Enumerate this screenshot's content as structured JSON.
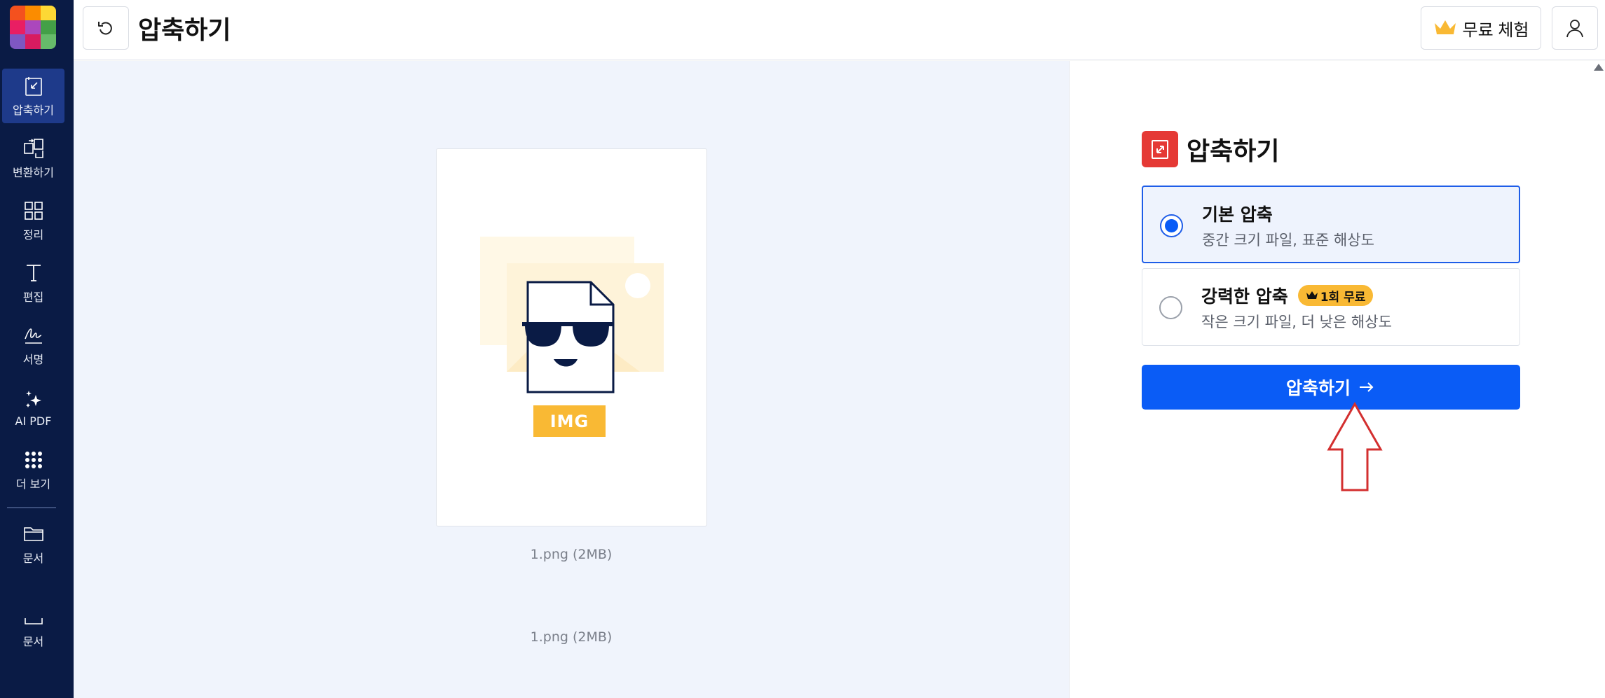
{
  "app": {
    "logo_colors": [
      "#f4511e",
      "#fb8c00",
      "#fdd835",
      "#e91e63",
      "#ab47bc",
      "#43a047",
      "#7e57c2",
      "#d81b60",
      "#66bb6a"
    ]
  },
  "sidebar": {
    "items": [
      {
        "label": "압축하기",
        "icon": "compress-icon",
        "active": true
      },
      {
        "label": "변환하기",
        "icon": "convert-icon",
        "active": false
      },
      {
        "label": "정리",
        "icon": "grid-icon",
        "active": false
      },
      {
        "label": "편집",
        "icon": "text-edit-icon",
        "active": false
      },
      {
        "label": "서명",
        "icon": "signature-icon",
        "active": false
      },
      {
        "label": "AI PDF",
        "icon": "sparkle-icon",
        "active": false
      },
      {
        "label": "더 보기",
        "icon": "dots-grid-icon",
        "active": false
      },
      {
        "label": "문서",
        "icon": "folder-icon",
        "active": false
      },
      {
        "label": "문서",
        "icon": "tray-icon",
        "active": false
      }
    ]
  },
  "header": {
    "title": "압축하기",
    "trial_label": "무료 체험"
  },
  "preview": {
    "badge": "IMG",
    "file_name": "1.png (2MB)",
    "file_name_2": "1.png (2MB)"
  },
  "panel": {
    "title": "압축하기",
    "options": [
      {
        "title": "기본 압축",
        "desc": "중간 크기 파일, 표준 해상도",
        "selected": true
      },
      {
        "title": "강력한 압축",
        "badge": "1회 무료",
        "desc": "작은 크기 파일, 더 낮은 해상도",
        "selected": false
      }
    ],
    "button_label": "압축하기"
  },
  "colors": {
    "sidebar_bg": "#0a1b45",
    "accent_blue": "#0a5cf6",
    "premium_yellow": "#f9b934",
    "compress_red": "#e53935",
    "hint_arrow": "#d32f2f"
  }
}
